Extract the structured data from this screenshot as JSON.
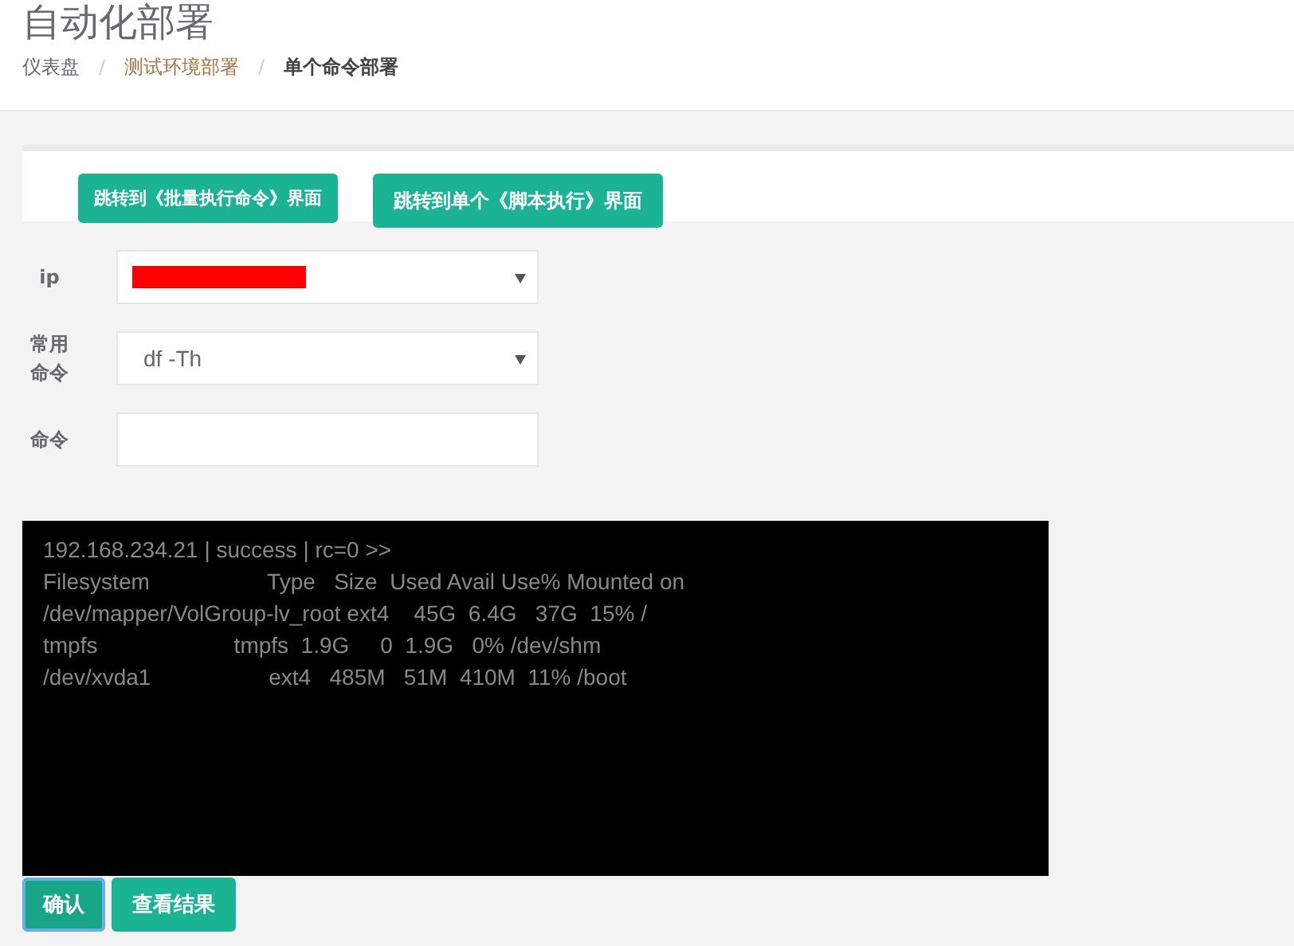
{
  "page": {
    "title": "自动化部署"
  },
  "breadcrumb": [
    {
      "label": "仪表盘",
      "selected": false,
      "kind": "plain"
    },
    {
      "label": "测试环境部署",
      "selected": false,
      "kind": "link"
    },
    {
      "label": "单个命令部署",
      "selected": true,
      "kind": "plain"
    }
  ],
  "breadcrumb_separator": "/",
  "nav_buttons": [
    "跳转到《批量执行命令》界面",
    "跳转到单个《脚本执行》界面"
  ],
  "form": [
    {
      "label": "ip",
      "kind": "select",
      "redacted": true
    },
    {
      "label": "常用命令",
      "kind": "select",
      "value": "df -Th"
    },
    {
      "label": "命令",
      "kind": "input"
    }
  ],
  "output_lines": [
    "192.168.234.21 | success | rc=0 >>",
    "Filesystem                   Type   Size  Used Avail Use% Mounted on",
    "/dev/mapper/VolGroup-lv_root ext4    45G  6.4G   37G  15% /",
    "tmpfs                      tmpfs  1.9G     0  1.9G   0% /dev/shm",
    "/dev/xvda1                   ext4   485M   51M  410M  11% /boot"
  ],
  "action_buttons": [
    {
      "label": "确认",
      "focused": true
    },
    {
      "label": "查看结果",
      "focused": false
    }
  ]
}
